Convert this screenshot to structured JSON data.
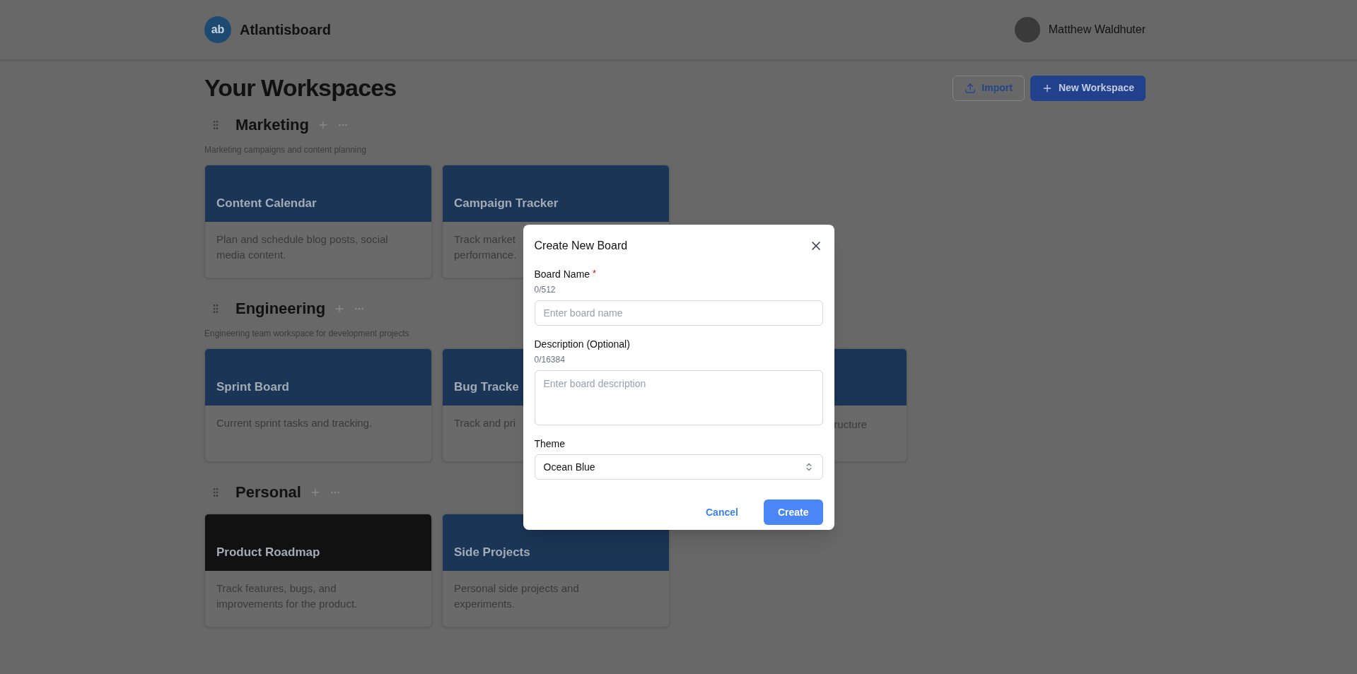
{
  "app": {
    "logo": "ab",
    "name": "Atlantisboard"
  },
  "user": {
    "name": "Matthew Waldhuter"
  },
  "page": {
    "title": "Your Workspaces",
    "actions": [
      {
        "label": "Import",
        "kind": "outline"
      },
      {
        "label": "New Workspace",
        "kind": "primary"
      }
    ]
  },
  "workspaces": [
    {
      "name": "Marketing",
      "description": "Marketing campaigns and content planning",
      "boards": [
        {
          "kind": "full",
          "title": "Content Calendar",
          "description": "Plan and schedule blog posts, social media content.",
          "color": "#1b3556"
        },
        {
          "kind": "full",
          "title": "Campaign Tracker",
          "description": "Track market\nperformance.",
          "color": "#1b3556"
        }
      ]
    },
    {
      "name": "Engineering",
      "description": "Engineering team workspace for development projects",
      "boards": [
        {
          "kind": "full",
          "title": "Sprint Board",
          "description": "Current sprint tasks and tracking.",
          "color": "#1b3556"
        },
        {
          "kind": "full",
          "title": "Bug Tracke",
          "description": "Track and pri",
          "color": "#1b3556"
        },
        {
          "kind": "fragment",
          "description": "ructure",
          "color": "#1b3556"
        }
      ]
    },
    {
      "name": "Personal",
      "boards": [
        {
          "kind": "full",
          "title": "Product Roadmap",
          "description": "Track features, bugs, and improvements for the product.",
          "color": "#111111"
        },
        {
          "kind": "full",
          "title": "Side Projects",
          "description": "Personal side projects and experiments.",
          "color": "#1b3556"
        }
      ]
    }
  ],
  "dialog": {
    "title": "Create New Board",
    "name_field": {
      "label": "Board Name",
      "required_mark": "*",
      "counter": "0/512",
      "placeholder": "Enter board name"
    },
    "description_field": {
      "label": "Description (Optional)",
      "counter": "0/16384",
      "placeholder": "Enter board description"
    },
    "theme_field": {
      "label": "Theme",
      "value": "Ocean Blue"
    },
    "buttons": [
      {
        "label": "Cancel",
        "kind": "text"
      },
      {
        "label": "Create",
        "kind": "primary"
      }
    ]
  }
}
